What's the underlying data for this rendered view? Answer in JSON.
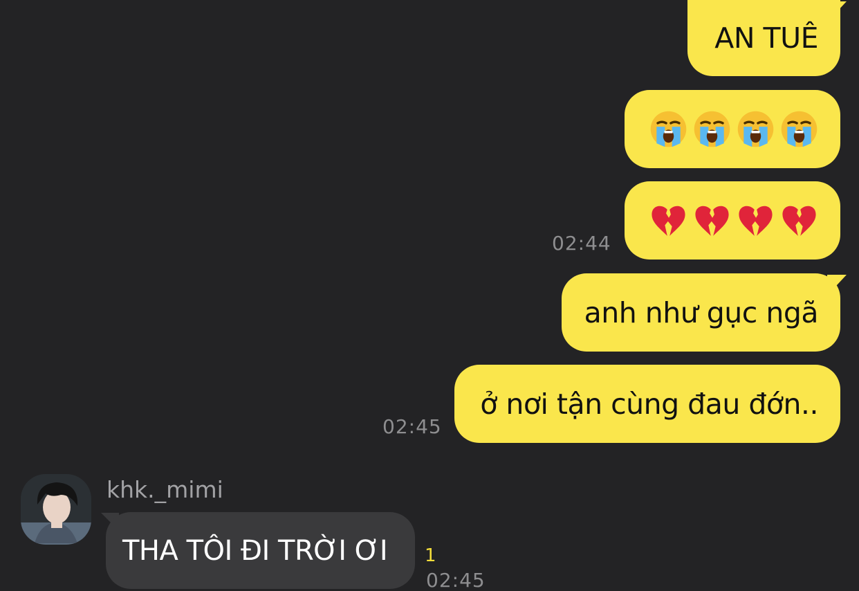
{
  "outgoing": [
    {
      "text": "AN TUÊ"
    },
    {
      "emoji": [
        "loudly-crying-face",
        "loudly-crying-face",
        "loudly-crying-face",
        "loudly-crying-face"
      ]
    },
    {
      "emoji": [
        "broken-heart",
        "broken-heart",
        "broken-heart",
        "broken-heart"
      ],
      "time": "02:44"
    },
    {
      "text": "anh như gục ngã"
    },
    {
      "text": "ở nơi tận cùng đau đớn..",
      "time": "02:45"
    }
  ],
  "incoming": {
    "sender": "khk._mimi",
    "text": "THA TÔI ĐI TRỜI ƠI",
    "unread": "1",
    "time": "02:45",
    "avatar": "avatar-icon"
  },
  "colors": {
    "background": "#232325",
    "outgoing_bubble": "#fae64c",
    "incoming_bubble": "#3a3a3c",
    "timestamp": "#8e8e90",
    "unread": "#f5de3a"
  }
}
